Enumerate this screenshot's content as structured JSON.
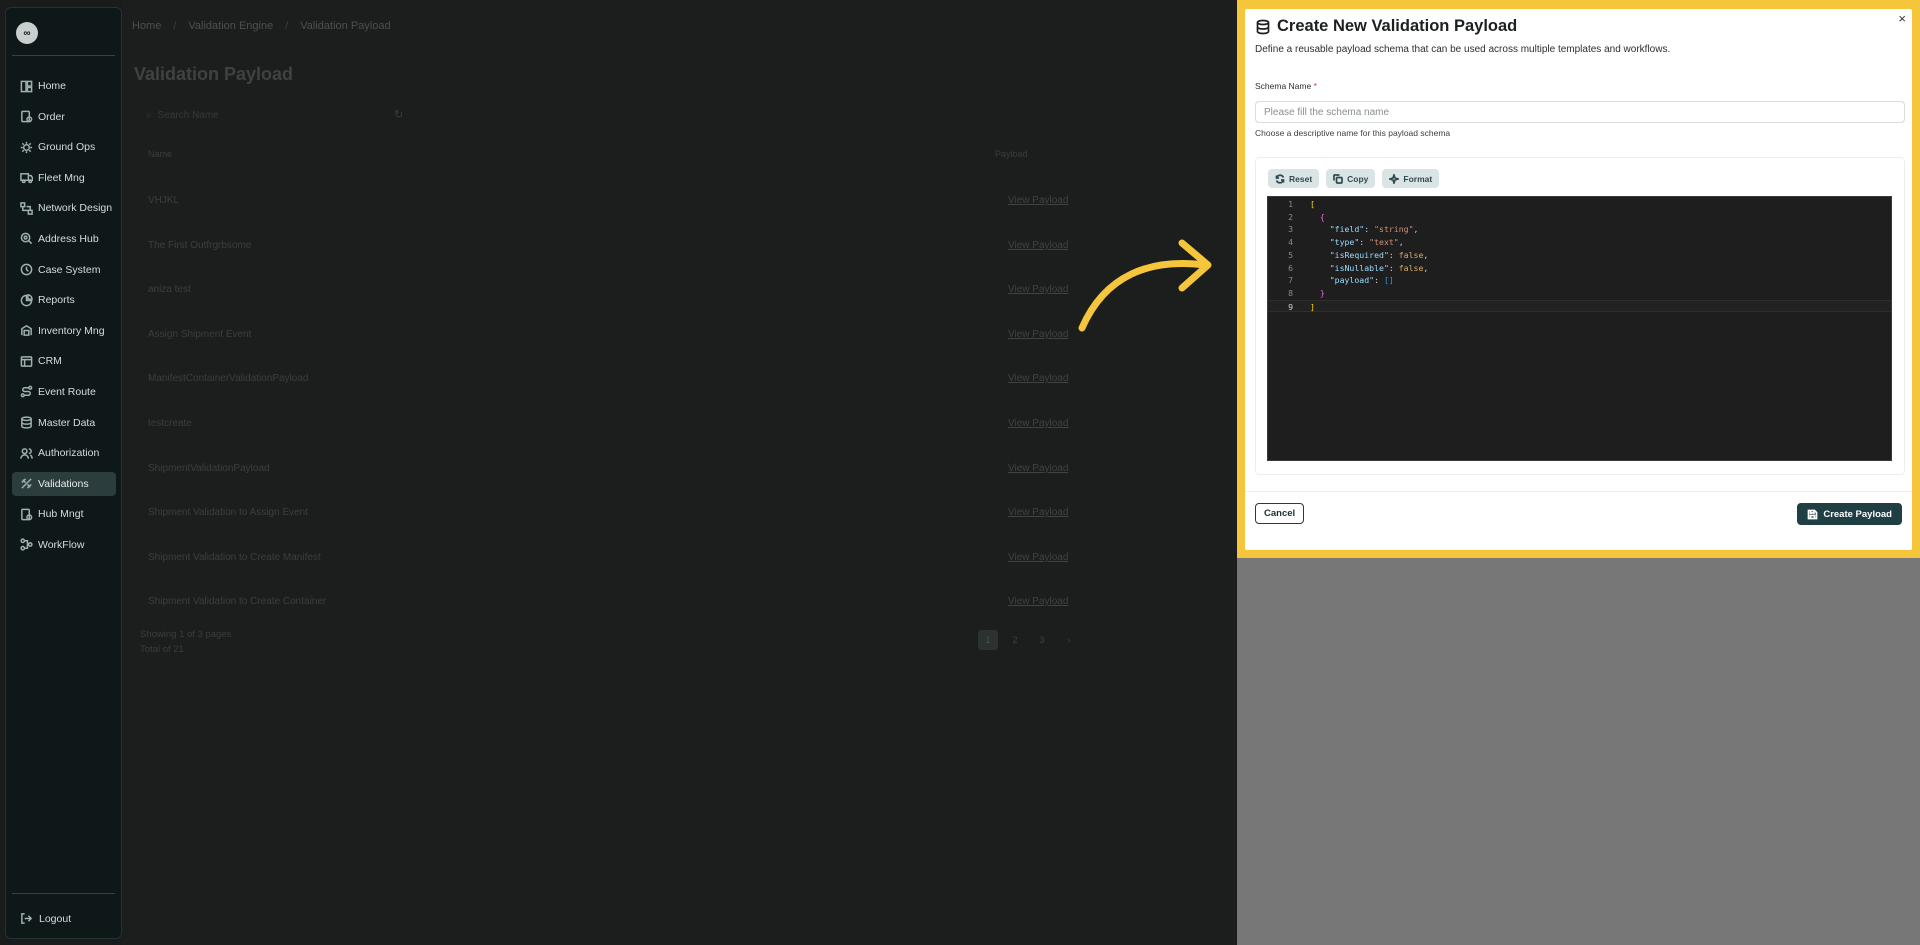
{
  "sidebar": {
    "logo": "∞",
    "items": [
      {
        "label": "Home",
        "icon": "home-icon"
      },
      {
        "label": "Order",
        "icon": "order-icon"
      },
      {
        "label": "Ground Ops",
        "icon": "ground-ops-icon"
      },
      {
        "label": "Fleet Mng",
        "icon": "truck-icon"
      },
      {
        "label": "Network Design",
        "icon": "network-icon"
      },
      {
        "label": "Address Hub",
        "icon": "address-icon"
      },
      {
        "label": "Case System",
        "icon": "case-icon"
      },
      {
        "label": "Reports",
        "icon": "reports-icon"
      },
      {
        "label": "Inventory Mng",
        "icon": "inventory-icon"
      },
      {
        "label": "CRM",
        "icon": "crm-icon"
      },
      {
        "label": "Event Route",
        "icon": "route-icon"
      },
      {
        "label": "Master Data",
        "icon": "database-icon"
      },
      {
        "label": "Authorization",
        "icon": "users-icon"
      },
      {
        "label": "Validations",
        "icon": "validations-icon",
        "active": true
      },
      {
        "label": "Hub Mngt",
        "icon": "hub-icon"
      },
      {
        "label": "WorkFlow",
        "icon": "workflow-icon"
      }
    ],
    "logout": "Logout"
  },
  "background": {
    "breadcrumb": [
      "Home",
      "Validation Engine",
      "Validation Payload"
    ],
    "title": "Validation Payload",
    "search_placeholder": "Search Name",
    "columns": [
      "Name",
      "Payload"
    ],
    "rows": [
      {
        "name": "VHJKL",
        "link": "View Payload"
      },
      {
        "name": "The First Outfrgrbsome",
        "link": "View Payload"
      },
      {
        "name": "aniza test",
        "link": "View Payload"
      },
      {
        "name": "Assign Shipment Event",
        "link": "View Payload"
      },
      {
        "name": "ManifestContainerValidationPayload",
        "link": "View Payload"
      },
      {
        "name": "testcreate",
        "link": "View Payload"
      },
      {
        "name": "ShipmentValidationPayload",
        "link": "View Payload"
      },
      {
        "name": "Shipment Validation to Assign Event",
        "link": "View Payload"
      },
      {
        "name": "Shipment Validation to Create Manifest",
        "link": "View Payload"
      },
      {
        "name": "Shipment Validation to Create Container",
        "link": "View Payload"
      }
    ],
    "page_info_1": "Showing 1 of 3 pages",
    "page_info_2": "Total of 21",
    "pages": [
      "1",
      "2",
      "3",
      "›"
    ]
  },
  "modal": {
    "title": "Create New Validation Payload",
    "subtitle": "Define a reusable payload schema that can be used across multiple templates and workflows.",
    "schema_label": "Schema Name",
    "required_mark": "*",
    "schema_placeholder": "Please fill the schema name",
    "schema_hint": "Choose a descriptive name for this payload schema",
    "toolbar": {
      "reset": "Reset",
      "copy": "Copy",
      "format": "Format"
    },
    "code_lines": [
      "1",
      "2",
      "3",
      "4",
      "5",
      "6",
      "7",
      "8",
      "9"
    ],
    "cancel": "Cancel",
    "create": "Create Payload",
    "close": "×"
  },
  "colors": {
    "highlight": "#f5c63c",
    "primary": "#1f3f44"
  }
}
